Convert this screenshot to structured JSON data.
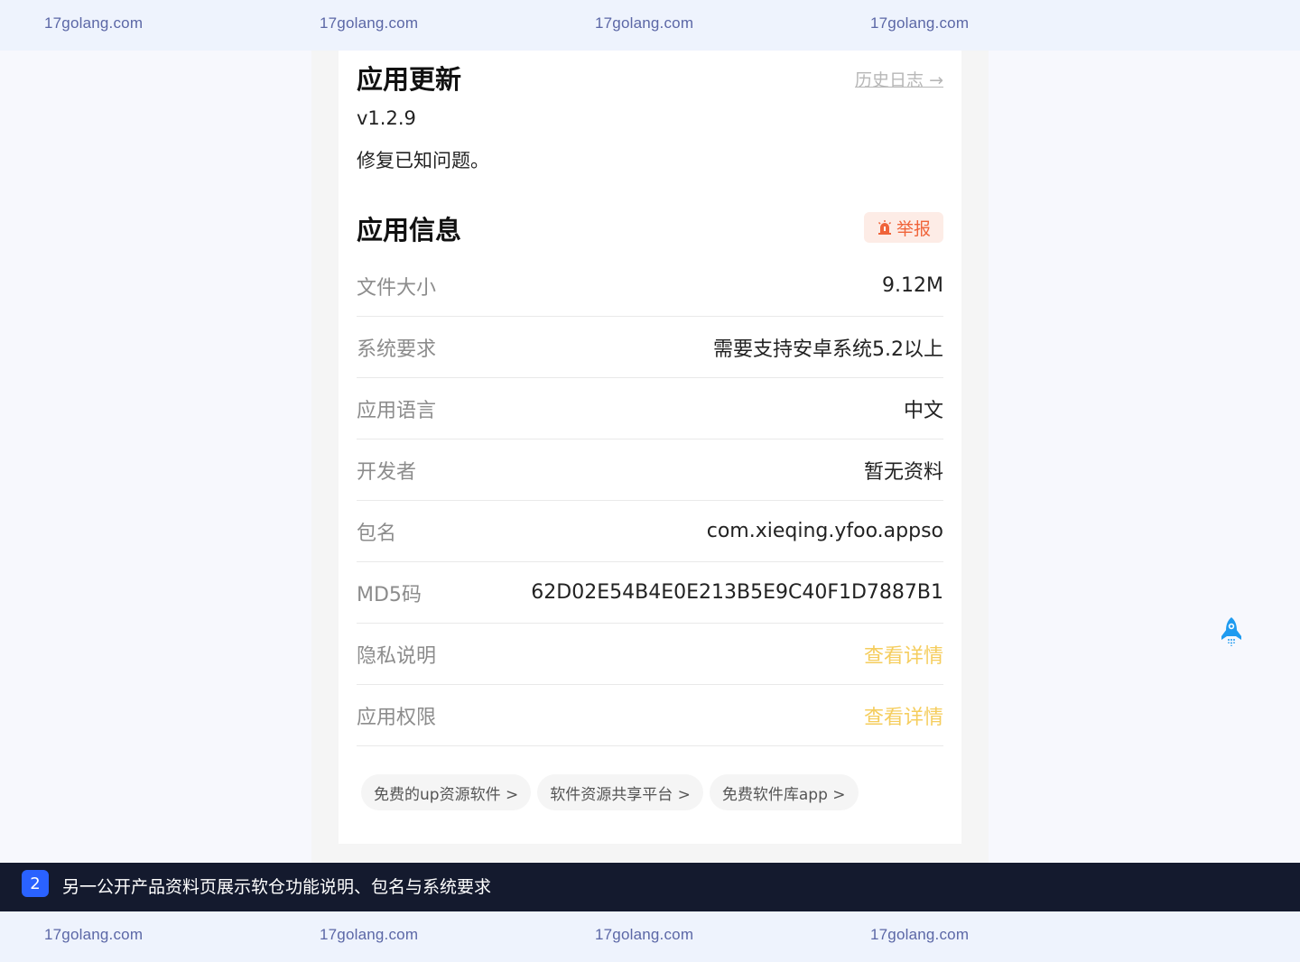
{
  "watermark": {
    "text": "17golang.com"
  },
  "update": {
    "title": "应用更新",
    "history_link": "历史日志 →",
    "version": "v1.2.9",
    "note": "修复已知问题。"
  },
  "info": {
    "title": "应用信息",
    "report_label": "举报",
    "rows": [
      {
        "key": "文件大小",
        "value": "9.12M"
      },
      {
        "key": "系统要求",
        "value": "需要支持安卓系统5.2以上"
      },
      {
        "key": "应用语言",
        "value": "中文"
      },
      {
        "key": "开发者",
        "value": "暂无资料"
      },
      {
        "key": "包名",
        "value": "com.xieqing.yfoo.appso"
      },
      {
        "key": "MD5码",
        "value": "62D02E54B4E0E213B5E9C40F1D7887B1"
      },
      {
        "key": "隐私说明",
        "value": "查看详情"
      },
      {
        "key": "应用权限",
        "value": "查看详情"
      }
    ]
  },
  "tags": [
    "免费的up资源软件 >",
    "软件资源共享平台 >",
    "免费软件库app >"
  ],
  "caption": {
    "number": "2",
    "text": "另一公开产品资料页展示软仓功能说明、包名与系统要求"
  },
  "colors": {
    "accent_link": "#f5cd5d",
    "report": "#f0643a",
    "caption_badge": "#2a62ff"
  }
}
